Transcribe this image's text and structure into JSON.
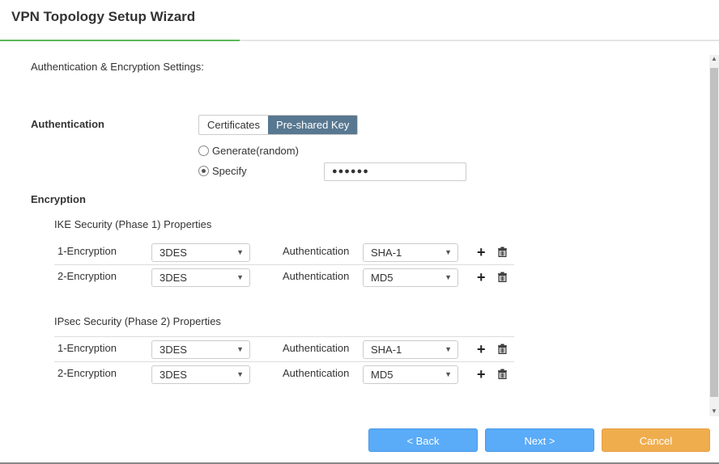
{
  "title": "VPN Topology Setup Wizard",
  "section_heading": "Authentication & Encryption Settings:",
  "authentication": {
    "label": "Authentication",
    "tabs": [
      "Certificates",
      "Pre-shared Key"
    ],
    "active_tab": "Pre-shared Key",
    "options": [
      {
        "label": "Generate(random)",
        "selected": false
      },
      {
        "label": "Specify",
        "selected": true
      }
    ],
    "key_value": "●●●●●●"
  },
  "encryption": {
    "label": "Encryption",
    "phase1": {
      "title": "IKE Security (Phase 1) Properties",
      "rows": [
        {
          "label": "1-Encryption",
          "encryption": "3DES",
          "auth_label": "Authentication",
          "auth": "SHA-1"
        },
        {
          "label": "2-Encryption",
          "encryption": "3DES",
          "auth_label": "Authentication",
          "auth": "MD5"
        }
      ]
    },
    "phase2": {
      "title": "IPsec Security (Phase 2) Properties",
      "rows": [
        {
          "label": "1-Encryption",
          "encryption": "3DES",
          "auth_label": "Authentication",
          "auth": "SHA-1"
        },
        {
          "label": "2-Encryption",
          "encryption": "3DES",
          "auth_label": "Authentication",
          "auth": "MD5"
        }
      ]
    }
  },
  "buttons": {
    "back": "< Back",
    "next": "Next >",
    "cancel": "Cancel"
  },
  "colors": {
    "progress": "#5cb85c",
    "active_tab": "#587891",
    "primary": "#5aabf8",
    "cancel": "#f0ad4e"
  }
}
